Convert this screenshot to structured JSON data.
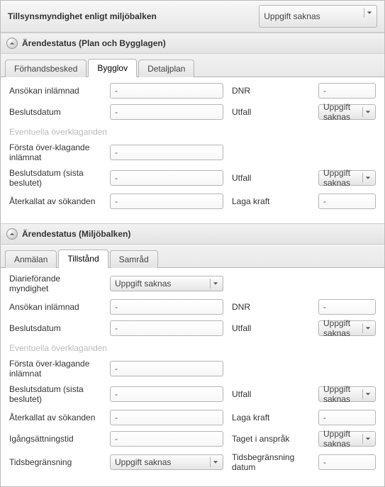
{
  "top": {
    "label": "Tillsynsmyndighet enligt miljöbalken",
    "value": "Uppgift saknas"
  },
  "sections": {
    "pbl": {
      "title": "Ärendestatus (Plan och Bygglagen)",
      "tabs": [
        "Förhandsbesked",
        "Bygglov",
        "Detaljplan"
      ],
      "active_tab": "Bygglov",
      "fields": {
        "ansokan_inlamnad_label": "Ansökan inlämnad",
        "ansokan_inlamnad_value": "-",
        "dnr_label": "DNR",
        "dnr_value": "-",
        "beslutsdatum_label": "Beslutsdatum",
        "beslutsdatum_value": "-",
        "utfall_label": "Utfall",
        "utfall_value": "Uppgift saknas",
        "overklag_header": "Eventuella överklaganden",
        "forsta_label": "Första över-klagande inlämnat",
        "forsta_value": "-",
        "beslut_sista_label": "Beslutsdatum (sista beslutet)",
        "beslut_sista_value": "-",
        "utfall2_label": "Utfall",
        "utfall2_value": "Uppgift saknas",
        "aterkallat_label": "Återkallat av sökanden",
        "aterkallat_value": "-",
        "lagakraft_label": "Laga kraft",
        "lagakraft_value": "-"
      }
    },
    "mb": {
      "title": "Ärendestatus (Miljöbalken)",
      "tabs": [
        "Anmälan",
        "Tillstånd",
        "Samråd"
      ],
      "active_tab": "Tillstånd",
      "fields": {
        "diarie_label": "Diarieförande myndighet",
        "diarie_value": "Uppgift saknas",
        "ansokan_inlamnad_label": "Ansökan inlämnad",
        "ansokan_inlamnad_value": "-",
        "dnr_label": "DNR",
        "dnr_value": "-",
        "beslutsdatum_label": "Beslutsdatum",
        "beslutsdatum_value": "-",
        "utfall_label": "Utfall",
        "utfall_value": "Uppgift saknas",
        "overklag_header": "Eventuella överklaganden",
        "forsta_label": "Första över-klagande inlämnat",
        "forsta_value": "-",
        "beslut_sista_label": "Beslutsdatum (sista beslutet)",
        "beslut_sista_value": "-",
        "utfall2_label": "Utfall",
        "utfall2_value": "Uppgift saknas",
        "aterkallat_label": "Återkallat av sökanden",
        "aterkallat_value": "-",
        "lagakraft_label": "Laga kraft",
        "lagakraft_value": "-",
        "igang_label": "Igångsättningstid",
        "igang_value": "-",
        "taget_label": "Taget i anspråk",
        "taget_value": "Uppgift saknas",
        "tidsbegr_label": "Tidsbegränsning",
        "tidsbegr_value": "Uppgift saknas",
        "tidsbegr_datum_label": "Tidsbegränsning datum",
        "tidsbegr_datum_value": "-"
      }
    }
  }
}
